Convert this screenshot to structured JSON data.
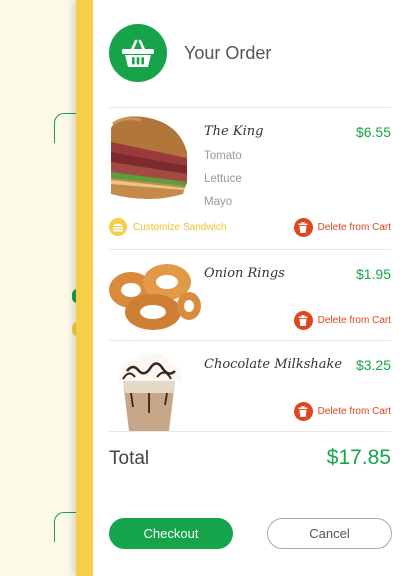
{
  "order": {
    "title": "Your Order",
    "items": [
      {
        "name": "The King",
        "price": "$6.55",
        "options": [
          "Tomato",
          "Lettuce",
          "Mayo"
        ],
        "customize_label": "Customize Sandwich",
        "delete_label": "Delete from Cart"
      },
      {
        "name": "Onion Rings",
        "price": "$1.95",
        "delete_label": "Delete from Cart"
      },
      {
        "name": "Chocolate Milkshake",
        "price": "$3.25",
        "delete_label": "Delete from Cart"
      }
    ],
    "total_label": "Total",
    "total_value": "$17.85"
  },
  "actions": {
    "checkout_label": "Checkout",
    "cancel_label": "Cancel"
  },
  "colors": {
    "accent_green": "#16a44a",
    "accent_yellow": "#f6cf4a",
    "delete_red": "#e0451b"
  },
  "icons": {
    "header": "basket-icon",
    "customize": "sandwich-icon",
    "delete": "trash-icon"
  }
}
